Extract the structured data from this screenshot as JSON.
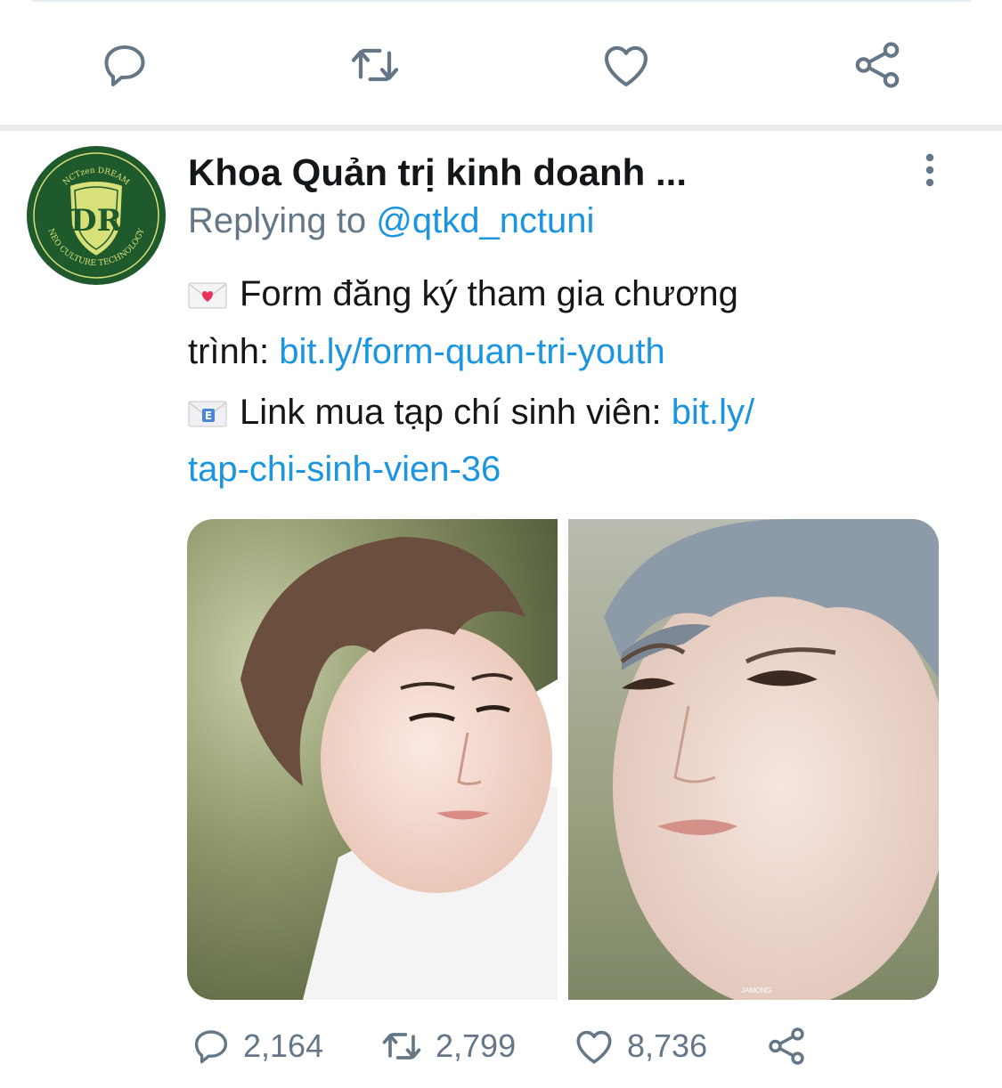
{
  "previous_tweet_actions": {
    "reply_icon": "reply-icon",
    "retweet_icon": "retweet-icon",
    "like_icon": "like-icon",
    "share_icon": "share-icon"
  },
  "tweet": {
    "author": "Khoa Quản trị kinh doanh ...",
    "replying_prefix": "Replying to ",
    "replying_handle": "@qtkd_nctuni",
    "avatar_badge_top": "NCTzen DREAM",
    "avatar_badge_bottom": "NEO CULTURE TECHNOLOGY",
    "line1_text": "Form đăng ký tham gia chương",
    "line2_text": "trình: ",
    "line2_link": "bit.ly/form-quan-tri-youth",
    "line3_text": "Link mua tạp chí sinh viên: ",
    "line3_link": "bit.ly/",
    "line4_link": "tap-chi-sinh-vien-36",
    "emoji1": "love-letter-icon",
    "emoji2": "email-icon",
    "photo_watermark": "JAMONG",
    "stats": {
      "replies": "2,164",
      "retweets": "2,799",
      "likes": "8,736"
    }
  },
  "colors": {
    "text": "#14171a",
    "secondary": "#657786",
    "link": "#1b95e0",
    "avatar_green": "#1f5a2c"
  }
}
